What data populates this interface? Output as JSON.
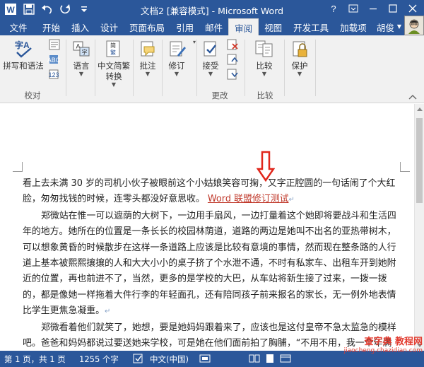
{
  "titlebar": {
    "title": "文档2 [兼容模式] - Microsoft Word",
    "qat": [
      "word-icon",
      "save-icon",
      "undo-icon",
      "redo-icon",
      "customize-icon"
    ],
    "controls": [
      "help-icon",
      "ribbon-display-icon",
      "minimize-icon",
      "maximize-icon",
      "close-icon"
    ]
  },
  "tabs": {
    "file": "文件",
    "items": [
      "开始",
      "插入",
      "设计",
      "页面布局",
      "引用",
      "邮件",
      "审阅",
      "视图",
      "开发工具",
      "加载项"
    ],
    "active": "审阅",
    "user": "胡俊"
  },
  "ribbon": {
    "proofing": {
      "btn": "拼写和语法",
      "group": "校对"
    },
    "language": {
      "btn": "语言"
    },
    "chinese": {
      "btn_line1": "中文简繁",
      "btn_line2": "转换"
    },
    "comments": {
      "btn": "批注"
    },
    "tracking": {
      "btn": "修订"
    },
    "changes": {
      "btn": "接受",
      "group": "更改"
    },
    "compare": {
      "btn": "比较",
      "group": "比较"
    },
    "protect": {
      "btn": "保护"
    }
  },
  "document": {
    "p1_text": "看上去未满 30 岁的司机小伙子被眼前这个小姑娘笑容可掬，又字正腔圆的一句话闹了个大红脸，匆匆找钱的时候，连零头都没好意思收。",
    "p1_revision": "Word 联盟修订测试",
    "p2": "郑微站在惟一可以遮荫的大树下，一边用手扇风，一边打量着这个她即将要战斗和生活四年的地方。她所在的位置是一条长长的校园林荫道，道路的两边是她叫不出名的亚热带树木，可以想象黄昏的时候散步在这样一条道路上应该是比较有意境的事情，然而现在整条路的人行道上基本被熙熙攘攘的人和大大小小的桌子挤了个水泄不通，不时有私家车、出租车开到她附近的位置，再也前进不了，当然，更多的是学校的大巴，从车站将新生接了过来，一拨一拨的，都是像她一样拖着大件行李的年轻面孔，还有陪同孩子前来报名的家长，无一例外地表情比学生更焦急凝重。",
    "p3": "郑微看着他们就笑了，她想，要是她妈妈跟着来了，应该也是这付皇帝不急太监急的模样吧。爸爸和妈妈都说过要送她来学校，可是她在他们面前拍了胸脯，“不用不用，我一个年满十八岁的聪明少女，难道连入学报到都应付不来？你们老跟着未免太小看人了，别忘了"
  },
  "statusbar": {
    "page": "第 1 页，共 1 页",
    "words": "1255 个字",
    "language": "中文(中国)"
  },
  "watermark": {
    "main": "查字典 教程网",
    "sub": "jiaocheng.chazidian.com"
  },
  "colors": {
    "brand": "#2b579a",
    "revision": "#c0392b",
    "arrow": "#e0261b"
  }
}
